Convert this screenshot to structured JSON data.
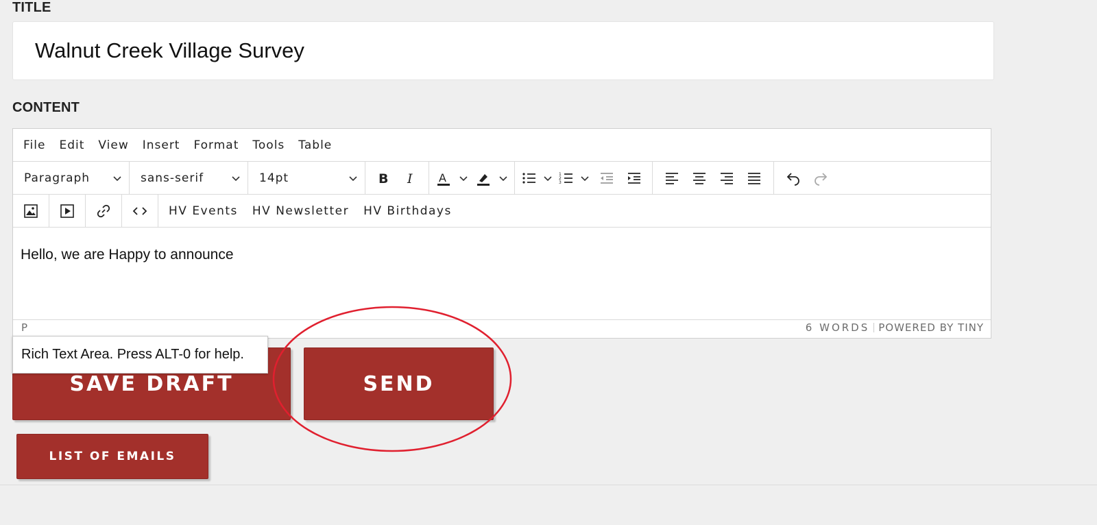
{
  "title_field": {
    "label": "TITLE",
    "value": "Walnut Creek Village Survey"
  },
  "content_field": {
    "label": "CONTENT"
  },
  "editor": {
    "menu": [
      "File",
      "Edit",
      "View",
      "Insert",
      "Format",
      "Tools",
      "Table"
    ],
    "block_format": "Paragraph",
    "font_family": "sans-serif",
    "font_size": "14pt",
    "custom_buttons": [
      "HV Events",
      "HV Newsletter",
      "HV Birthdays"
    ],
    "body_text": "Hello, we are Happy to announce",
    "status": {
      "path": "P",
      "word_count": "6 WORDS",
      "powered_by": "POWERED BY TINY"
    },
    "tooltip": "Rich Text Area. Press ALT-0 for help."
  },
  "actions": {
    "save_draft": "SAVE DRAFT",
    "send": "SEND",
    "list_of_emails": "LIST OF EMAILS"
  },
  "colors": {
    "button_bg": "#a3302b",
    "annotation_circle": "#e0202f",
    "page_bg": "#efefef"
  }
}
